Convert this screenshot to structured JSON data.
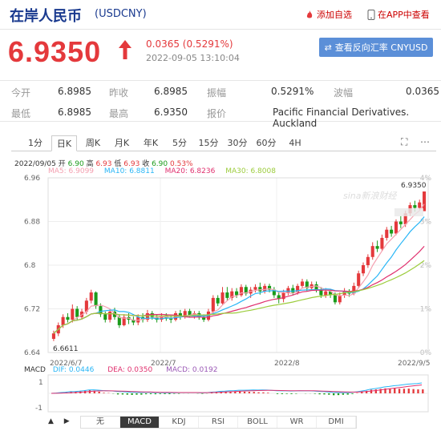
{
  "header": {
    "title": "在岸人民币",
    "code": "(USDCNY)",
    "favorite_label": "添加自选",
    "app_label": "在APP中查看"
  },
  "quote": {
    "price": "6.9350",
    "change": "0.0365 (0.5291%)",
    "time": "2022-09-05 13:10:04",
    "reverse_button": "查看反向汇率 CNYUSD"
  },
  "stats": {
    "open_label": "今开",
    "open_value": "6.8985",
    "prev_label": "昨收",
    "prev_value": "6.8985",
    "amp_label": "振幅",
    "amp_value": "0.5291%",
    "wave_label": "波幅",
    "wave_value": "0.0365",
    "low_label": "最低",
    "low_value": "6.8985",
    "high_label": "最高",
    "high_value": "6.9350",
    "quote_label": "报价",
    "quote_value": "Pacific Financial Derivatives. Auckland"
  },
  "tabs": [
    "1分",
    "日K",
    "周K",
    "月K",
    "年K",
    "5分",
    "15分",
    "30分",
    "60分",
    "4H"
  ],
  "active_tab": "日K",
  "info": {
    "date": "2022/09/05",
    "open_label": "开",
    "open": "6.90",
    "high_label": "高",
    "high": "6.93",
    "low_label": "低",
    "low": "6.93",
    "close_label": "收",
    "close": "6.90",
    "pct": "0.53%",
    "ma5": "MA5: 6.9099",
    "ma10": "MA10: 6.8811",
    "ma20": "MA20: 6.8236",
    "ma30": "MA30: 6.8008"
  },
  "colors": {
    "up": "#e4393c",
    "down": "#1a9b1a",
    "ma5": "#f4a0b0",
    "ma10": "#29b6f6",
    "ma20": "#e0306e",
    "ma30": "#9ccc3c",
    "accent": "#5b8fd8"
  },
  "chart_data": {
    "type": "candlestick",
    "y_ticks_left": [
      "6.96",
      "6.88",
      "6.8",
      "6.72",
      "6.64"
    ],
    "y_ticks_right": [
      "4%",
      "3%",
      "2%",
      "1%",
      "0%"
    ],
    "x_ticks": [
      "2022/6/7",
      "2022/7",
      "2022/8",
      "2022/9/5"
    ],
    "ylim": [
      6.64,
      6.96
    ],
    "last_label": "6.9350",
    "low_label": "6.6611",
    "watermark": "sina新浪财经",
    "candles": [
      [
        6.665,
        6.675,
        6.661,
        6.68
      ],
      [
        6.675,
        6.69,
        6.67,
        6.695
      ],
      [
        6.69,
        6.705,
        6.685,
        6.71
      ],
      [
        6.705,
        6.7,
        6.695,
        6.712
      ],
      [
        6.7,
        6.72,
        6.695,
        6.728
      ],
      [
        6.72,
        6.705,
        6.7,
        6.725
      ],
      [
        6.705,
        6.715,
        6.7,
        6.72
      ],
      [
        6.715,
        6.735,
        6.71,
        6.74
      ],
      [
        6.735,
        6.75,
        6.73,
        6.755
      ],
      [
        6.75,
        6.725,
        6.72,
        6.752
      ],
      [
        6.725,
        6.71,
        6.705,
        6.73
      ],
      [
        6.71,
        6.7,
        6.695,
        6.715
      ],
      [
        6.7,
        6.715,
        6.695,
        6.72
      ],
      [
        6.715,
        6.705,
        6.7,
        6.722
      ],
      [
        6.705,
        6.69,
        6.685,
        6.71
      ],
      [
        6.69,
        6.705,
        6.688,
        6.71
      ],
      [
        6.705,
        6.7,
        6.692,
        6.712
      ],
      [
        6.7,
        6.695,
        6.69,
        6.706
      ],
      [
        6.695,
        6.705,
        6.69,
        6.71
      ],
      [
        6.705,
        6.7,
        6.695,
        6.712
      ],
      [
        6.7,
        6.712,
        6.696,
        6.718
      ],
      [
        6.712,
        6.705,
        6.7,
        6.716
      ],
      [
        6.705,
        6.7,
        6.695,
        6.71
      ],
      [
        6.7,
        6.708,
        6.696,
        6.712
      ],
      [
        6.708,
        6.702,
        6.698,
        6.712
      ],
      [
        6.702,
        6.7,
        6.694,
        6.708
      ],
      [
        6.7,
        6.712,
        6.697,
        6.716
      ],
      [
        6.712,
        6.705,
        6.7,
        6.718
      ],
      [
        6.705,
        6.716,
        6.702,
        6.72
      ],
      [
        6.716,
        6.708,
        6.704,
        6.72
      ],
      [
        6.708,
        6.712,
        6.702,
        6.716
      ],
      [
        6.712,
        6.705,
        6.7,
        6.716
      ],
      [
        6.705,
        6.7,
        6.696,
        6.71
      ],
      [
        6.7,
        6.715,
        6.697,
        6.72
      ],
      [
        6.715,
        6.74,
        6.712,
        6.745
      ],
      [
        6.74,
        6.73,
        6.725,
        6.745
      ],
      [
        6.73,
        6.75,
        6.728,
        6.76
      ],
      [
        6.75,
        6.74,
        6.735,
        6.76
      ],
      [
        6.74,
        6.752,
        6.735,
        6.758
      ],
      [
        6.752,
        6.745,
        6.74,
        6.758
      ],
      [
        6.745,
        6.76,
        6.742,
        6.765
      ],
      [
        6.76,
        6.748,
        6.744,
        6.764
      ],
      [
        6.748,
        6.755,
        6.74,
        6.76
      ],
      [
        6.755,
        6.76,
        6.75,
        6.765
      ],
      [
        6.76,
        6.752,
        6.746,
        6.768
      ],
      [
        6.752,
        6.762,
        6.748,
        6.766
      ],
      [
        6.762,
        6.755,
        6.75,
        6.766
      ],
      [
        6.755,
        6.745,
        6.74,
        6.76
      ],
      [
        6.745,
        6.738,
        6.73,
        6.75
      ],
      [
        6.738,
        6.75,
        6.732,
        6.755
      ],
      [
        6.75,
        6.758,
        6.745,
        6.762
      ],
      [
        6.758,
        6.75,
        6.745,
        6.764
      ],
      [
        6.75,
        6.762,
        6.746,
        6.766
      ],
      [
        6.762,
        6.77,
        6.758,
        6.775
      ],
      [
        6.77,
        6.758,
        6.752,
        6.774
      ],
      [
        6.758,
        6.765,
        6.754,
        6.77
      ],
      [
        6.765,
        6.755,
        6.75,
        6.77
      ],
      [
        6.755,
        6.745,
        6.74,
        6.76
      ],
      [
        6.745,
        6.752,
        6.74,
        6.758
      ],
      [
        6.752,
        6.745,
        6.74,
        6.756
      ],
      [
        6.745,
        6.732,
        6.728,
        6.75
      ],
      [
        6.732,
        6.745,
        6.728,
        6.75
      ],
      [
        6.745,
        6.752,
        6.74,
        6.758
      ],
      [
        6.752,
        6.748,
        6.742,
        6.756
      ],
      [
        6.748,
        6.762,
        6.745,
        6.768
      ],
      [
        6.762,
        6.785,
        6.758,
        6.79
      ],
      [
        6.785,
        6.8,
        6.78,
        6.805
      ],
      [
        6.8,
        6.815,
        6.795,
        6.82
      ],
      [
        6.815,
        6.835,
        6.81,
        6.842
      ],
      [
        6.835,
        6.83,
        6.824,
        6.845
      ],
      [
        6.83,
        6.85,
        6.826,
        6.856
      ],
      [
        6.85,
        6.865,
        6.845,
        6.87
      ],
      [
        6.865,
        6.858,
        6.852,
        6.872
      ],
      [
        6.858,
        6.88,
        6.855,
        6.884
      ],
      [
        6.88,
        6.875,
        6.868,
        6.89
      ],
      [
        6.875,
        6.895,
        6.87,
        6.9
      ],
      [
        6.895,
        6.91,
        6.89,
        6.915
      ],
      [
        6.91,
        6.905,
        6.898,
        6.918
      ],
      [
        6.905,
        6.915,
        6.9,
        6.92
      ],
      [
        6.899,
        6.935,
        6.899,
        6.935
      ]
    ]
  },
  "macd": {
    "label": "MACD",
    "dif": "DIF: 0.0446",
    "dea": "DEA: 0.0350",
    "macd": "MACD: 0.0192",
    "y_ticks": [
      "1",
      "-1"
    ]
  },
  "indicators": [
    "无",
    "MACD",
    "KDJ",
    "RSI",
    "BOLL",
    "WR",
    "DMI"
  ],
  "active_indicator": "MACD"
}
